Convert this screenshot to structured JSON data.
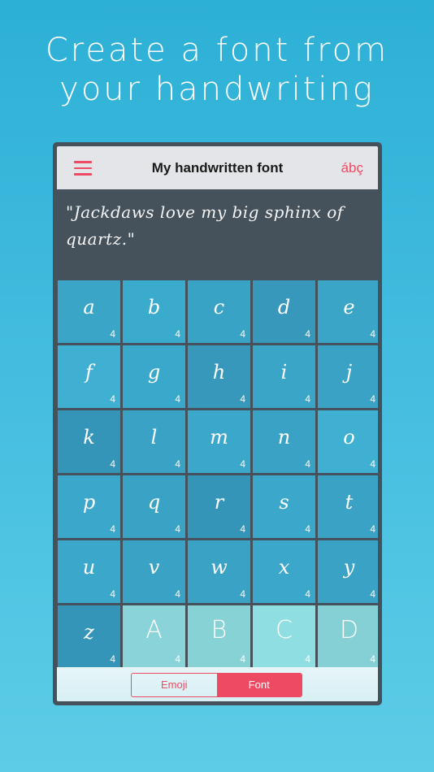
{
  "headline": {
    "line1": "Create a font from",
    "line2": "your handwriting"
  },
  "navbar": {
    "title": "My handwritten font",
    "right_label": "ábç",
    "menu_icon": "hamburger-menu-icon"
  },
  "preview": {
    "text": "\"Jackdaws love my big sphinx of quartz.\""
  },
  "colors": {
    "accent": "#ee4a63",
    "background_top": "#2db0d6",
    "background_bottom": "#5ccde6",
    "frame": "#46525b",
    "upper_cell": "#8ad3d8"
  },
  "glyphs": [
    {
      "char": "a",
      "count": "4"
    },
    {
      "char": "b",
      "count": "4"
    },
    {
      "char": "c",
      "count": "4"
    },
    {
      "char": "d",
      "count": "4"
    },
    {
      "char": "e",
      "count": "4"
    },
    {
      "char": "f",
      "count": "4"
    },
    {
      "char": "g",
      "count": "4"
    },
    {
      "char": "h",
      "count": "4"
    },
    {
      "char": "i",
      "count": "4"
    },
    {
      "char": "j",
      "count": "4"
    },
    {
      "char": "k",
      "count": "4"
    },
    {
      "char": "l",
      "count": "4"
    },
    {
      "char": "m",
      "count": "4"
    },
    {
      "char": "n",
      "count": "4"
    },
    {
      "char": "o",
      "count": "4"
    },
    {
      "char": "p",
      "count": "4"
    },
    {
      "char": "q",
      "count": "4"
    },
    {
      "char": "r",
      "count": "4"
    },
    {
      "char": "s",
      "count": "4"
    },
    {
      "char": "t",
      "count": "4"
    },
    {
      "char": "u",
      "count": "4"
    },
    {
      "char": "v",
      "count": "4"
    },
    {
      "char": "w",
      "count": "4"
    },
    {
      "char": "x",
      "count": "4"
    },
    {
      "char": "y",
      "count": "4"
    },
    {
      "char": "z",
      "count": "4"
    },
    {
      "char": "A",
      "count": "4"
    },
    {
      "char": "B",
      "count": "4"
    },
    {
      "char": "C",
      "count": "4"
    },
    {
      "char": "D",
      "count": "4"
    }
  ],
  "segmented": {
    "left_label": "Emoji",
    "right_label": "Font",
    "selected": "Font"
  }
}
